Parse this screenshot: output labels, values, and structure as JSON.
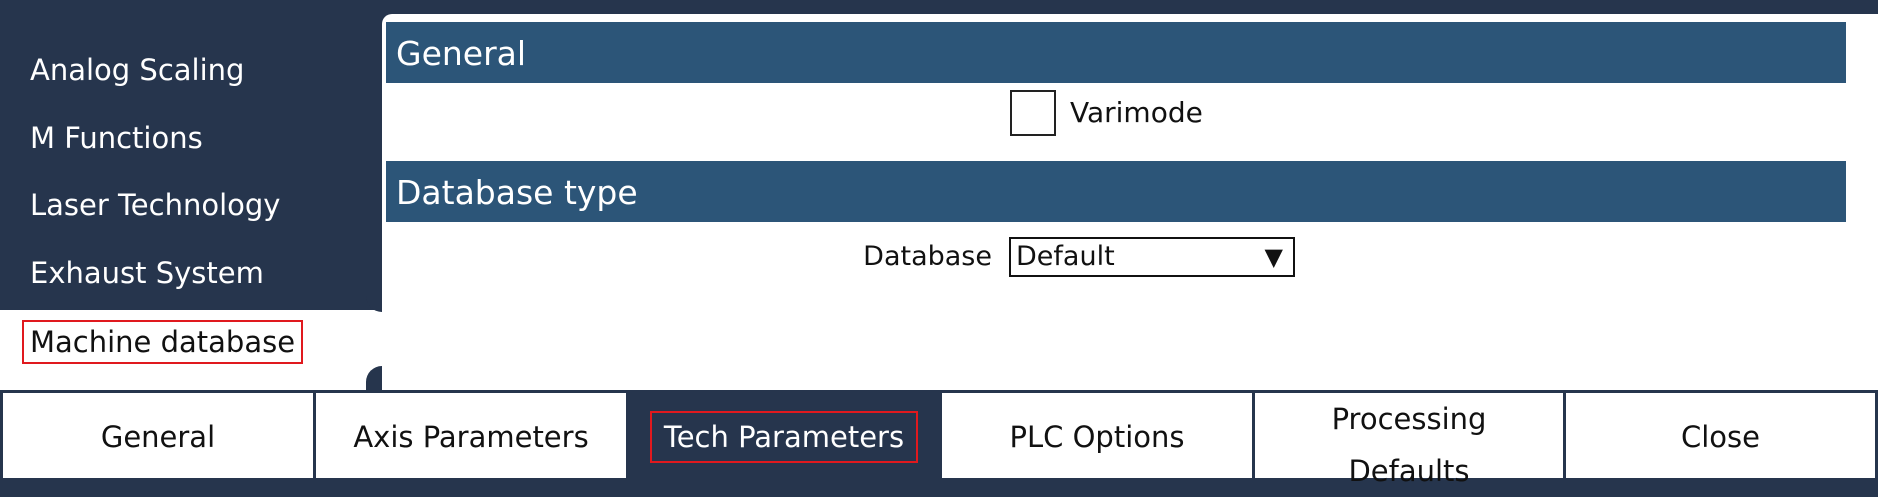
{
  "sidebar": {
    "items": [
      {
        "label": "Analog Scaling"
      },
      {
        "label": "M Functions"
      },
      {
        "label": "Laser Technology"
      },
      {
        "label": "Exhaust System"
      },
      {
        "label": "Machine database"
      }
    ],
    "selected_index": 4
  },
  "main": {
    "general": {
      "title": "General",
      "varimode_label": "Varimode",
      "varimode_checked": false
    },
    "database_type": {
      "title": "Database type",
      "database_label": "Database",
      "database_value": "Default",
      "dropdown_arrow": "▼"
    }
  },
  "tabs": [
    {
      "label": "General"
    },
    {
      "label": "Axis Parameters"
    },
    {
      "label": "Tech Parameters"
    },
    {
      "label": "PLC Options"
    },
    {
      "label": "Processing Defaults"
    },
    {
      "label": "Close"
    }
  ],
  "active_tab_index": 2,
  "colors": {
    "background": "#26354d",
    "section_header": "#2c5578",
    "highlight_outline": "#e0191e",
    "panel": "#ffffff"
  }
}
